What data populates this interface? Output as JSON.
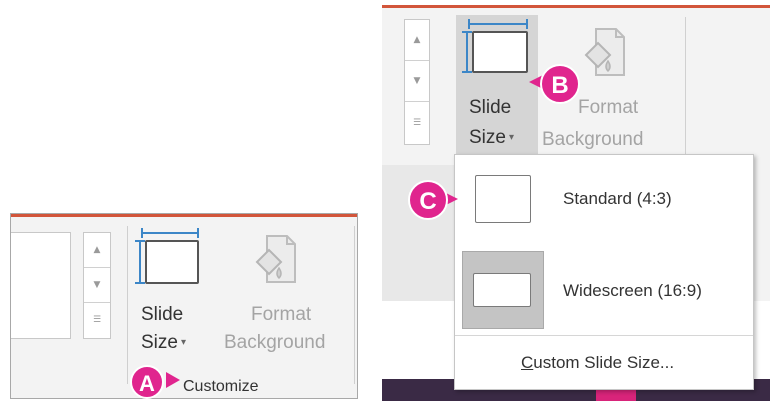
{
  "left_panel": {
    "slide_size_line1": "Slide",
    "slide_size_line2": "Size",
    "format_line1": "Format",
    "format_line2": "Background",
    "group_label": "Customize",
    "marker": "A"
  },
  "right_panel": {
    "slide_size_line1": "Slide",
    "slide_size_line2": "Size",
    "format_line1": "Format",
    "format_line2": "Background",
    "marker_b": "B",
    "marker_c": "C",
    "dropdown": {
      "items": [
        {
          "label": "Standard (4:3)"
        },
        {
          "label": "Widescreen (16:9)"
        }
      ],
      "custom_prefix": "C",
      "custom_rest": "ustom Slide Size..."
    }
  },
  "icons": {
    "scroll_up": "▲",
    "scroll_down": "▼",
    "scroll_more": "☰",
    "caret": "▾"
  },
  "colors": {
    "accent_orange": "#d2553a",
    "marker_magenta": "#e0258e",
    "ruler_blue": "#3c86c7"
  }
}
